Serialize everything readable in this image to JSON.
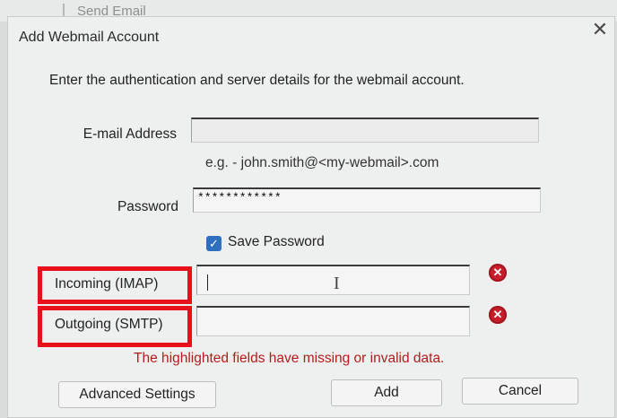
{
  "background": {
    "window_item": "Send Email"
  },
  "dialog": {
    "title": "Add Webmail Account",
    "close_icon": "close-icon",
    "instructions": "Enter the authentication and server details for the webmail account."
  },
  "form": {
    "email": {
      "label": "E-mail Address",
      "value": "",
      "hint": "e.g. - john.smith@<my-webmail>.com"
    },
    "password": {
      "label": "Password",
      "value": "************"
    },
    "save_password": {
      "label": "Save Password",
      "checked": true
    },
    "incoming": {
      "label": "Incoming (IMAP)",
      "value": ""
    },
    "outgoing": {
      "label": "Outgoing (SMTP)",
      "value": ""
    },
    "error_message": "The highlighted fields have missing or invalid data."
  },
  "buttons": {
    "advanced": "Advanced Settings",
    "add": "Add",
    "cancel": "Cancel"
  },
  "colors": {
    "highlight": "#e8101b",
    "error_text": "#b71c1c",
    "checkbox": "#2e6fc0"
  }
}
